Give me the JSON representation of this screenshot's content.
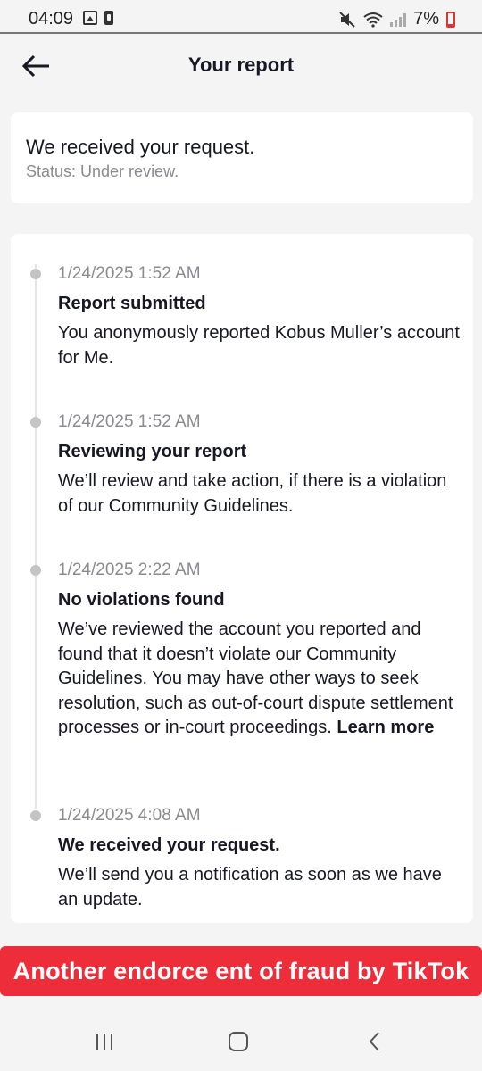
{
  "status_bar": {
    "time": "04:09",
    "battery": "7%"
  },
  "header": {
    "title": "Your report",
    "back_icon": "arrow-left-icon"
  },
  "status_card": {
    "title": "We received your request.",
    "subtitle": "Status: Under review."
  },
  "timeline": [
    {
      "date": "1/24/2025 1:52 AM",
      "title": "Report submitted",
      "desc": "You anonymously reported Kobus Muller’s account for Me."
    },
    {
      "date": "1/24/2025 1:52 AM",
      "title": "Reviewing your report",
      "desc": "We’ll review and take action, if there is a violation of our Community Guidelines."
    },
    {
      "date": "1/24/2025 2:22 AM",
      "title": "No violations found",
      "desc": "We’ve reviewed the account you reported and found that it doesn’t violate our Community Guidelines. You may have other ways to seek resolution, such as out-of-court dispute settlement processes or in-court proceedings.",
      "link": "Learn more"
    },
    {
      "date": "1/24/2025 4:08 AM",
      "title": "We received your request.",
      "desc": "We’ll send you a notification as soon as we have an update."
    }
  ],
  "banner": {
    "text": "Another endorce ent of fraud by TikTok",
    "color": "#ee2d3b"
  },
  "nav": {
    "recent_icon": "recent-apps-icon",
    "home_icon": "home-icon",
    "back_icon": "back-chevron-icon"
  }
}
